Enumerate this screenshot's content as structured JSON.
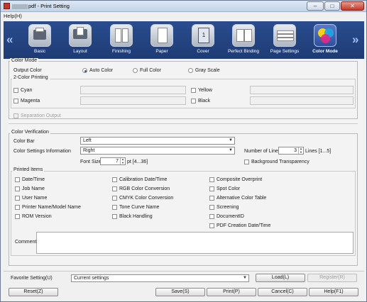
{
  "window": {
    "title": "pdf - Print Setting",
    "controls": {
      "minimize": "–",
      "maximize": "□",
      "close": "✕"
    }
  },
  "menu": {
    "help": "Help(H)"
  },
  "toolbar": {
    "prev_arrow": "«",
    "next_arrow": "»",
    "items": [
      {
        "label": "Basic",
        "icon": "basic-icon"
      },
      {
        "label": "Layout",
        "icon": "layout-icon"
      },
      {
        "label": "Finishing",
        "icon": "finishing-icon"
      },
      {
        "label": "Paper",
        "icon": "paper-icon"
      },
      {
        "label": "Cover",
        "icon": "cover-icon",
        "glyph": "1"
      },
      {
        "label": "Perfect Binding",
        "icon": "perfect-binding-icon"
      },
      {
        "label": "Page Settings",
        "icon": "page-settings-icon"
      },
      {
        "label": "Color Mode",
        "icon": "color-mode-icon",
        "selected": true
      }
    ]
  },
  "color_mode": {
    "group_title": "Color Mode",
    "output_color_label": "Output Color",
    "options": [
      "Auto Color",
      "Full Color",
      "Gray Scale"
    ],
    "selected": "Auto Color"
  },
  "two_color": {
    "group_title": "2-Color Printing",
    "cyan": "Cyan",
    "magenta": "Magenta",
    "yellow": "Yellow",
    "black": "Black",
    "separation": "Separation Output"
  },
  "verification": {
    "group_title": "Color Verification",
    "color_bar_label": "Color Bar",
    "color_bar_value": "Left",
    "settings_info_label": "Color Settings Information",
    "settings_info_value": "Right",
    "lines_label": "Number of Lines",
    "lines_value": "3",
    "lines_range": "Lines [1...5]",
    "font_size_label": "Font Size",
    "font_size_value": "7",
    "font_size_range": "pt [4...36]",
    "bg_transparency": "Background Transparency"
  },
  "printed_items": {
    "group_title": "Printed Items",
    "col1": [
      "Date/Time",
      "Job Name",
      "User Name",
      "Printer Name/Model Name",
      "ROM Version"
    ],
    "col2": [
      "Calibration Date/Time",
      "RGB Color Conversion",
      "CMYK Color Conversion",
      "Tone Curve Name",
      "Black Handling"
    ],
    "col3": [
      "Composite Overprint",
      "Spot Color",
      "Alternative Color Table",
      "Screening",
      "DocumentID",
      "PDF Creation Date/Time"
    ],
    "comment_label": "Comment"
  },
  "footer": {
    "favorite_label": "Favorite Setting(U)",
    "favorite_value": "Current settings",
    "load": "Load(L)",
    "register": "Register(R)",
    "reset": "Reset(Z)",
    "save": "Save(S)",
    "print": "Print(P)",
    "cancel": "Cancel(C)",
    "help": "Help(F1)"
  },
  "colors": {
    "toolbar_bg": "#2a4d8f",
    "selected_icon": "#3e62b5"
  }
}
